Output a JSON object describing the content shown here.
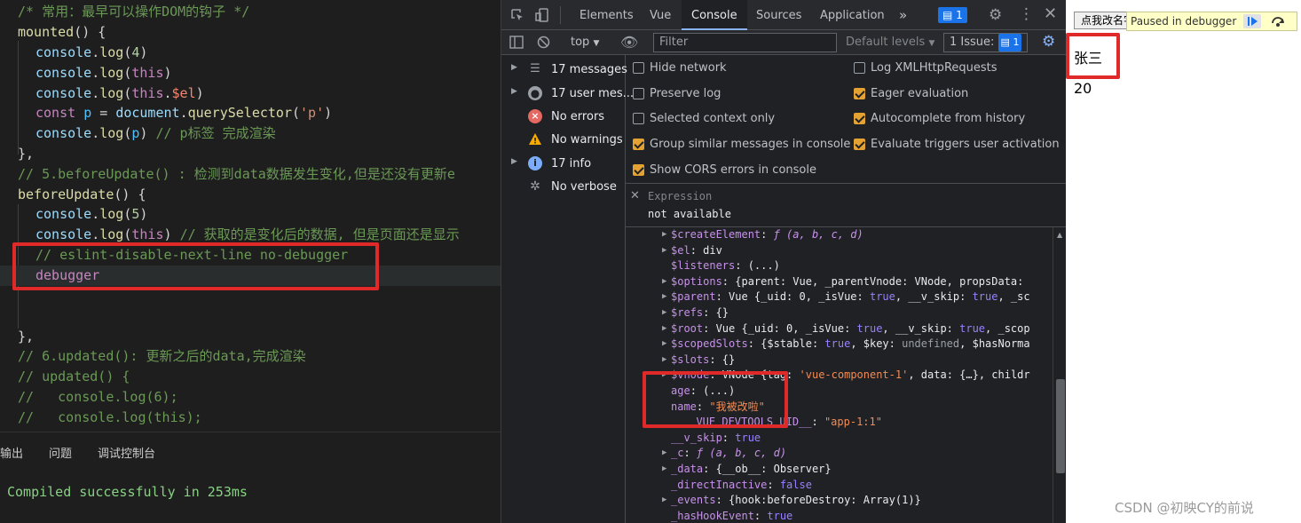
{
  "editor": {
    "lines": [
      {
        "cm": "/* 常用：最早可以操作DOM的钩子 */"
      },
      {
        "fn": "mounted",
        "plain": "() {"
      },
      {
        "obj": "console",
        "plain": ".",
        "fn": "log",
        "p2": "(",
        "num": "4",
        "p3": ")"
      },
      {
        "obj": "console",
        "plain": ".",
        "fn": "log",
        "p2": "(",
        "kw": "this",
        "p3": ")"
      },
      {
        "obj": "console",
        "plain": ".",
        "fn": "log",
        "p2": "(",
        "kw": "this",
        "p3": ".",
        "sv": "$el",
        "p4": ")"
      },
      {
        "kw": "const",
        "var": "p",
        "plain": " = ",
        "obj": "document",
        "p2": ".",
        "fn": "querySelector",
        "p3": "(",
        "str": "'p'",
        "p4": ")"
      },
      {
        "obj": "console",
        "plain": ".",
        "fn": "log",
        "p2": "(",
        "var": "p",
        "p3": ") ",
        "cm": "// p标签 完成渲染"
      },
      {
        "plain": "},"
      },
      {
        "cm": "// 5.beforeUpdate() : 检测到data数据发生变化,但是还没有更新e"
      },
      {
        "fn": "beforeUpdate",
        "plain": "() {"
      },
      {
        "obj": "console",
        "plain": ".",
        "fn": "log",
        "p2": "(",
        "num": "5",
        "p3": ")"
      },
      {
        "obj": "console",
        "plain": ".",
        "fn": "log",
        "p2": "(",
        "kw": "this",
        "p3": ") ",
        "cm": "// 获取的是变化后的数据, 但是页面还是显示"
      },
      {
        "cm": "// eslint-disable-next-line no-debugger"
      },
      {
        "kw": "debugger"
      },
      {
        "plain": ""
      },
      {
        "plain": ""
      },
      {
        "plain": "},"
      },
      {
        "cm": "// 6.updated(): 更新之后的data,完成渲染"
      },
      {
        "cm": "// updated() {"
      },
      {
        "cm": "//   console.log(6);"
      },
      {
        "cm": "//   console.log(this);"
      }
    ]
  },
  "panel": {
    "tabs": [
      "输出",
      "问题",
      "调试控制台"
    ],
    "compiled": "Compiled successfully in 253ms"
  },
  "devtools": {
    "tabs": [
      "Elements",
      "Vue",
      "Console",
      "Sources",
      "Application"
    ],
    "active_tab": "Console",
    "more": "»",
    "issues_badge": "1",
    "toolbar": {
      "context": "top",
      "filter_placeholder": "Filter",
      "levels": "Default levels",
      "issues": "1 Issue:",
      "issues_count": "1"
    },
    "sidebar": [
      {
        "label": "17 messages",
        "icon": "list-icon"
      },
      {
        "label": "17 user mes...",
        "icon": "user-icon"
      },
      {
        "label": "No errors",
        "icon": "error-icon"
      },
      {
        "label": "No warnings",
        "icon": "warning-icon"
      },
      {
        "label": "17 info",
        "icon": "info-icon"
      },
      {
        "label": "No verbose",
        "icon": "verbose-icon"
      }
    ],
    "settings_left": [
      {
        "label": "Hide network",
        "checked": false
      },
      {
        "label": "Preserve log",
        "checked": false
      },
      {
        "label": "Selected context only",
        "checked": false
      },
      {
        "label": "Group similar messages in console",
        "checked": true
      },
      {
        "label": "Show CORS errors in console",
        "checked": true
      }
    ],
    "settings_right": [
      {
        "label": "Log XMLHttpRequests",
        "checked": false
      },
      {
        "label": "Eager evaluation",
        "checked": true
      },
      {
        "label": "Autocomplete from history",
        "checked": true
      },
      {
        "label": "Evaluate triggers user activation",
        "checked": true
      }
    ],
    "expression": {
      "label": "Expression",
      "value": "not available"
    },
    "tree": [
      {
        "k": "$createElement",
        "v": ": ",
        "f": "ƒ (a, b, c, d)",
        "tri": true
      },
      {
        "k": "$el",
        "v": ": div",
        "tri": true
      },
      {
        "k": "$listeners",
        "v": ": (...)",
        "tri": false
      },
      {
        "k": "$options",
        "v": ": {parent: Vue, _parentVnode: VNode, propsData:",
        "tri": true
      },
      {
        "k": "$parent",
        "v": ": Vue {_uid: 0, _isVue: ",
        "b": "true",
        "v2": ", __v_skip: ",
        "b2": "true",
        "v3": ", _sc",
        "tri": true
      },
      {
        "k": "$refs",
        "v": ": {}",
        "tri": true
      },
      {
        "k": "$root",
        "v": ": Vue {_uid: 0, _isVue: ",
        "b": "true",
        "v2": ", __v_skip: ",
        "b2": "true",
        "v3": ", _scop",
        "tri": true
      },
      {
        "k": "$scopedSlots",
        "v": ": {$stable: ",
        "b": "true",
        "v2": ", $key: ",
        "u": "undefined",
        "v3": ", $hasNorma",
        "tri": true
      },
      {
        "k": "$slots",
        "v": ": {}",
        "tri": true
      },
      {
        "k": "$vnode",
        "v": ": VNode {tag: ",
        "s": "'vue-component-1'",
        "v2": ", data: {…}, childr",
        "tri": true
      },
      {
        "k": "age",
        "v": ": (...)",
        "tri": false
      },
      {
        "k": "name",
        "v": ": ",
        "s": "\"我被改啦\"",
        "tri": false
      },
      {
        "k": "__VUE_DEVTOOLS_UID__",
        "v": ": ",
        "s": "\"app-1:1\"",
        "tri": false,
        "indent": true
      },
      {
        "k": "__v_skip",
        "v": ": ",
        "b": "true",
        "tri": false
      },
      {
        "k": "_c",
        "v": ": ",
        "f": "ƒ (a, b, c, d)",
        "tri": true
      },
      {
        "k": "_data",
        "v": ": {__ob__: Observer}",
        "tri": true
      },
      {
        "k": "_directInactive",
        "v": ": ",
        "b": "false",
        "tri": false
      },
      {
        "k": "_events",
        "v": ": {hook:beforeDestroy: Array(1)}",
        "tri": true
      },
      {
        "k": "_hasHookEvent",
        "v": ": ",
        "b": "true",
        "tri": false
      }
    ]
  },
  "page": {
    "button": "点我改名字",
    "paused": "Paused in debugger",
    "name": "张三",
    "age": "20",
    "watermark": "CSDN @初映CY的前说"
  },
  "colors": {
    "highlight_box": "#e02929",
    "devtools_accent": "#8ab4f8",
    "checkbox_on": "#e4a232"
  }
}
